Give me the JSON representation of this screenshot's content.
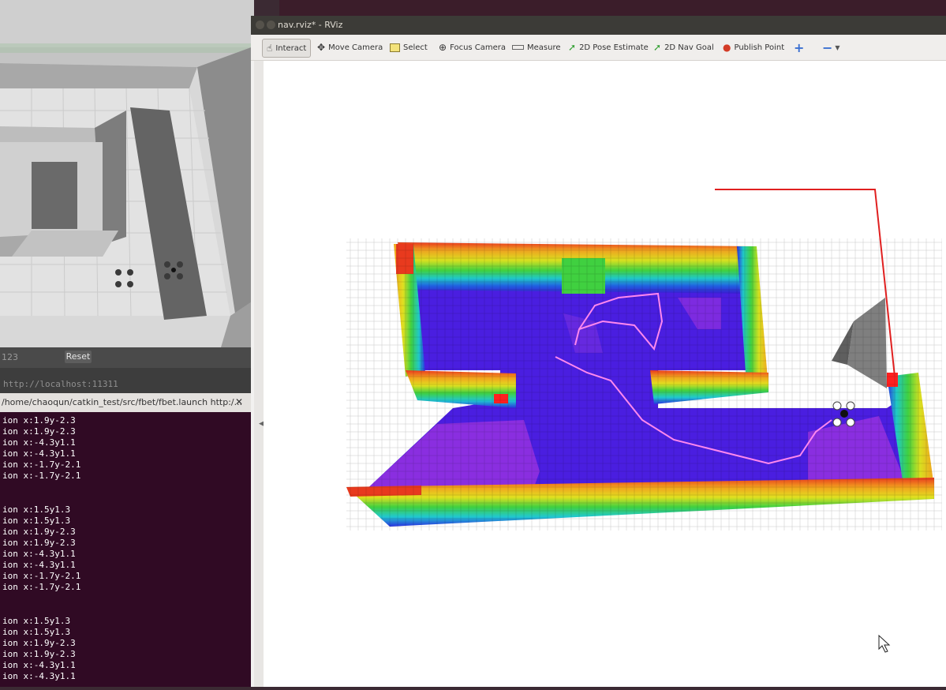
{
  "gazebo": {
    "field_value": "123",
    "reset_label": "Reset"
  },
  "terminal": {
    "url": "http://localhost:11311",
    "tab_label": "/home/chaoqun/catkin_test/src/fbet/fbet.launch http:/...",
    "lines": [
      "ion x:1.9y-2.3",
      "ion x:1.9y-2.3",
      "ion x:-4.3y1.1",
      "ion x:-4.3y1.1",
      "ion x:-1.7y-2.1",
      "ion x:-1.7y-2.1",
      "",
      "",
      "ion x:1.5y1.3",
      "ion x:1.5y1.3",
      "ion x:1.9y-2.3",
      "ion x:1.9y-2.3",
      "ion x:-4.3y1.1",
      "ion x:-4.3y1.1",
      "ion x:-1.7y-2.1",
      "ion x:-1.7y-2.1",
      "",
      "",
      "ion x:1.5y1.3",
      "ion x:1.5y1.3",
      "ion x:1.9y-2.3",
      "ion x:1.9y-2.3",
      "ion x:-4.3y1.1",
      "ion x:-4.3y1.1"
    ]
  },
  "rviz": {
    "title": "nav.rviz* - RViz",
    "tools": {
      "interact": "Interact",
      "move_camera": "Move Camera",
      "select": "Select",
      "focus_camera": "Focus Camera",
      "measure": "Measure",
      "pose_estimate": "2D Pose Estimate",
      "nav_goal": "2D Nav Goal",
      "publish_point": "Publish Point"
    },
    "icons": {
      "interact": "hand-icon",
      "move_camera": "move-arrows-icon",
      "select": "select-box-icon",
      "focus_camera": "focus-target-icon",
      "measure": "ruler-icon",
      "pose_estimate": "green-arrow-icon",
      "nav_goal": "green-arrow-icon",
      "publish_point": "map-pin-icon",
      "add": "plus-icon",
      "remove": "minus-icon"
    }
  }
}
